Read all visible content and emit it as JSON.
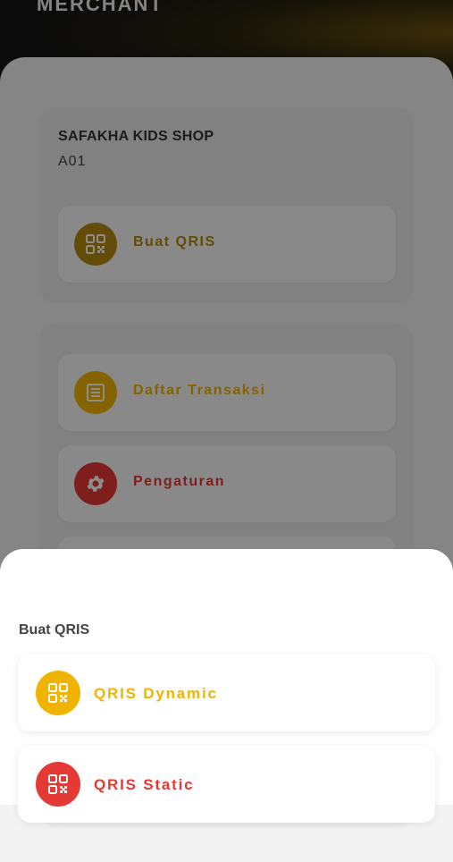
{
  "header": {
    "title": "MERCHANT"
  },
  "merchant": {
    "name": "SAFAKHA KIDS SHOP",
    "code": "A01"
  },
  "menu": [
    {
      "label": "Buat QRIS",
      "icon": "qr-code-icon",
      "color": "#b58a10"
    },
    {
      "label": "Daftar Transaksi",
      "icon": "list-icon",
      "color": "#f0b400"
    },
    {
      "label": "Pengaturan",
      "icon": "gear-icon",
      "color": "#e53935"
    }
  ],
  "sheet": {
    "title": "Buat QRIS",
    "options": [
      {
        "label": "QRIS Dynamic",
        "icon": "qr-code-icon",
        "color": "#f0b400"
      },
      {
        "label": "QRIS Static",
        "icon": "qr-code-icon",
        "color": "#e53935"
      }
    ]
  }
}
